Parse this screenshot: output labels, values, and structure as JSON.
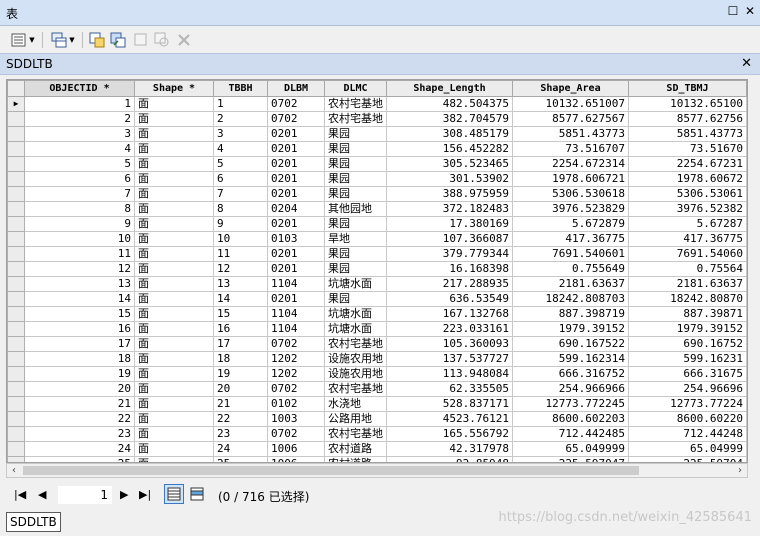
{
  "window": {
    "title": "表"
  },
  "table_tab": {
    "title": "SDDLTB"
  },
  "columns": [
    "OBJECTID *",
    "Shape *",
    "TBBH",
    "DLBM",
    "DLMC",
    "Shape_Length",
    "Shape_Area",
    "SD_TBMJ"
  ],
  "rows": [
    [
      "1",
      "面",
      "1",
      "0702",
      "农村宅基地",
      "482.504375",
      "10132.651007",
      "10132.65100"
    ],
    [
      "2",
      "面",
      "2",
      "0702",
      "农村宅基地",
      "382.704579",
      "8577.627567",
      "8577.62756"
    ],
    [
      "3",
      "面",
      "3",
      "0201",
      "果园",
      "308.485179",
      "5851.43773",
      "5851.43773"
    ],
    [
      "4",
      "面",
      "4",
      "0201",
      "果园",
      "156.452282",
      "73.516707",
      "73.51670"
    ],
    [
      "5",
      "面",
      "5",
      "0201",
      "果园",
      "305.523465",
      "2254.672314",
      "2254.67231"
    ],
    [
      "6",
      "面",
      "6",
      "0201",
      "果园",
      "301.53902",
      "1978.606721",
      "1978.60672"
    ],
    [
      "7",
      "面",
      "7",
      "0201",
      "果园",
      "388.975959",
      "5306.530618",
      "5306.53061"
    ],
    [
      "8",
      "面",
      "8",
      "0204",
      "其他园地",
      "372.182483",
      "3976.523829",
      "3976.52382"
    ],
    [
      "9",
      "面",
      "9",
      "0201",
      "果园",
      "17.380169",
      "5.672879",
      "5.67287"
    ],
    [
      "10",
      "面",
      "10",
      "0103",
      "旱地",
      "107.366087",
      "417.36775",
      "417.36775"
    ],
    [
      "11",
      "面",
      "11",
      "0201",
      "果园",
      "379.779344",
      "7691.540601",
      "7691.54060"
    ],
    [
      "12",
      "面",
      "12",
      "0201",
      "果园",
      "16.168398",
      "0.755649",
      "0.75564"
    ],
    [
      "13",
      "面",
      "13",
      "1104",
      "坑塘水面",
      "217.288935",
      "2181.63637",
      "2181.63637"
    ],
    [
      "14",
      "面",
      "14",
      "0201",
      "果园",
      "636.53549",
      "18242.808703",
      "18242.80870"
    ],
    [
      "15",
      "面",
      "15",
      "1104",
      "坑塘水面",
      "167.132768",
      "887.398719",
      "887.39871"
    ],
    [
      "16",
      "面",
      "16",
      "1104",
      "坑塘水面",
      "223.033161",
      "1979.39152",
      "1979.39152"
    ],
    [
      "17",
      "面",
      "17",
      "0702",
      "农村宅基地",
      "105.360093",
      "690.167522",
      "690.16752"
    ],
    [
      "18",
      "面",
      "18",
      "1202",
      "设施农用地",
      "137.537727",
      "599.162314",
      "599.16231"
    ],
    [
      "19",
      "面",
      "19",
      "1202",
      "设施农用地",
      "113.948084",
      "666.316752",
      "666.31675"
    ],
    [
      "20",
      "面",
      "20",
      "0702",
      "农村宅基地",
      "62.335505",
      "254.966966",
      "254.96696"
    ],
    [
      "21",
      "面",
      "21",
      "0102",
      "水浇地",
      "528.837171",
      "12773.772245",
      "12773.77224"
    ],
    [
      "22",
      "面",
      "22",
      "1003",
      "公路用地",
      "4523.76121",
      "8600.602203",
      "8600.60220"
    ],
    [
      "23",
      "面",
      "23",
      "0702",
      "农村宅基地",
      "165.556792",
      "712.442485",
      "712.44248"
    ],
    [
      "24",
      "面",
      "24",
      "1006",
      "农村道路",
      "42.317978",
      "65.049999",
      "65.04999"
    ],
    [
      "25",
      "面",
      "25",
      "1006",
      "农村道路",
      "92.85948",
      "225.597047",
      "225.59704"
    ]
  ],
  "navigation": {
    "current_record": "1",
    "status": "(0 / 716 已选择)"
  },
  "bottom_tab": {
    "label": "SDDLTB"
  },
  "watermark": "https://blog.csdn.net/weixin_42585641"
}
